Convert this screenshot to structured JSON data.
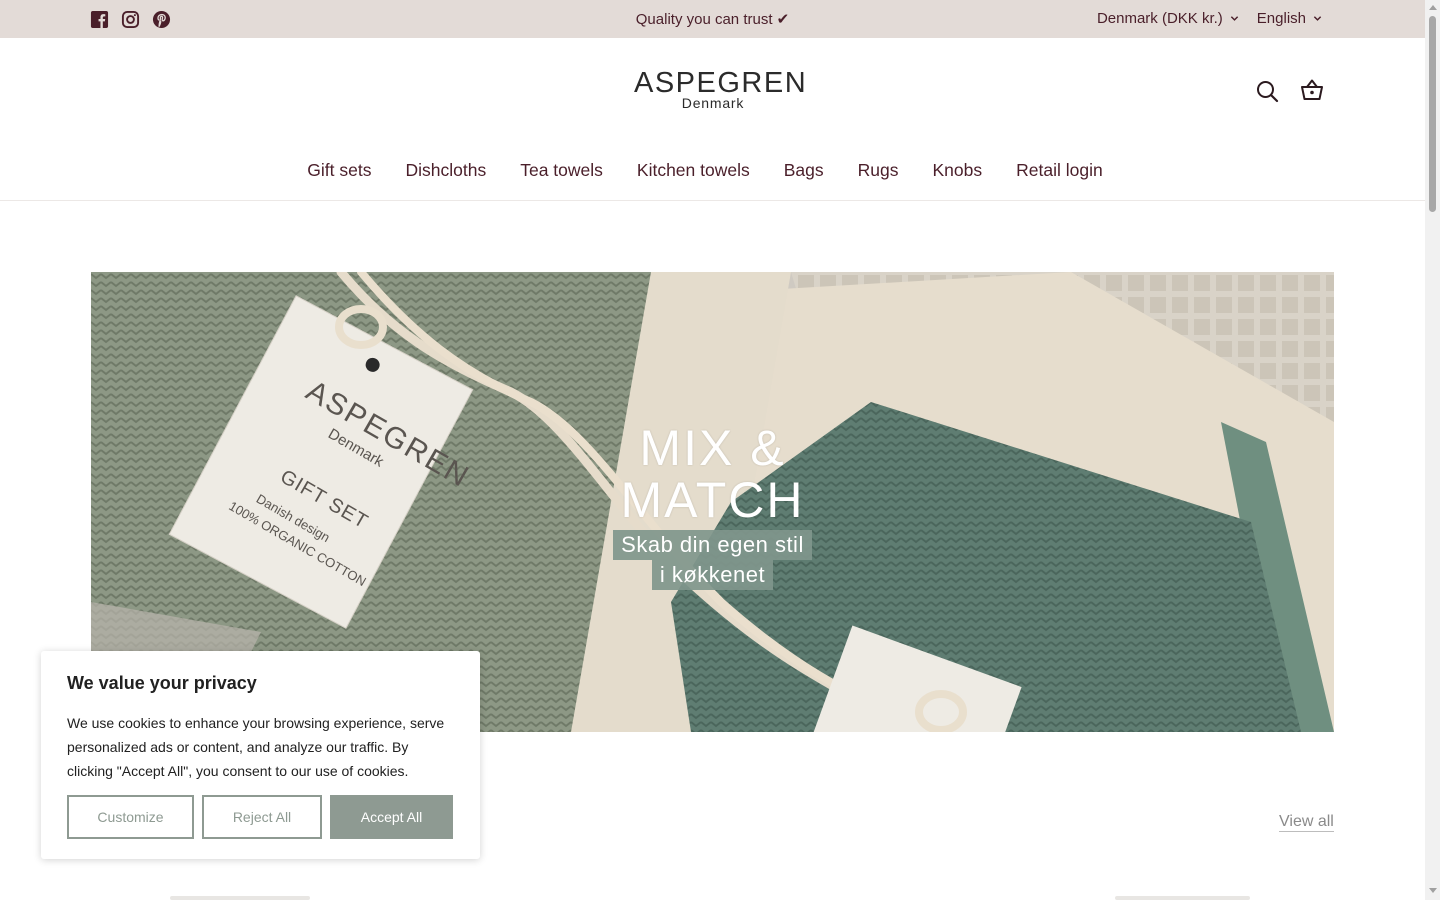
{
  "topbar": {
    "announcement": "Quality you can trust ✔",
    "country": "Denmark (DKK kr.)",
    "language": "English",
    "socials": [
      "facebook-icon",
      "instagram-icon",
      "pinterest-icon"
    ]
  },
  "header": {
    "logo_main": "ASPEGREN",
    "logo_sub": "Denmark",
    "nav": [
      "Gift sets",
      "Dishcloths",
      "Tea towels",
      "Kitchen towels",
      "Bags",
      "Rugs",
      "Knobs",
      "Retail login"
    ]
  },
  "hero": {
    "title_line1": "MIX &",
    "title_line2": "MATCH",
    "subtitle_line1": "Skab din egen stil",
    "subtitle_line2": "i køkkenet",
    "tag_brand": "ASPEGREN",
    "tag_brand_sub": "Denmark",
    "tag_label": "GIFT SET",
    "tag_line1": "Danish design",
    "tag_line2": "100% ORGANIC COTTON"
  },
  "collection": {
    "view_all": "View all"
  },
  "cookie": {
    "title": "We value your privacy",
    "text": "We use cookies to enhance your browsing experience, serve personalized ads or content, and analyze our traffic. By clicking \"Accept All\", you consent to our use of cookies.",
    "customize": "Customize",
    "reject": "Reject All",
    "accept": "Accept All"
  },
  "colors": {
    "topbar_bg": "#e3dbd7",
    "brand_text": "#4a1f2a",
    "accent_sage": "#8e9a92"
  }
}
